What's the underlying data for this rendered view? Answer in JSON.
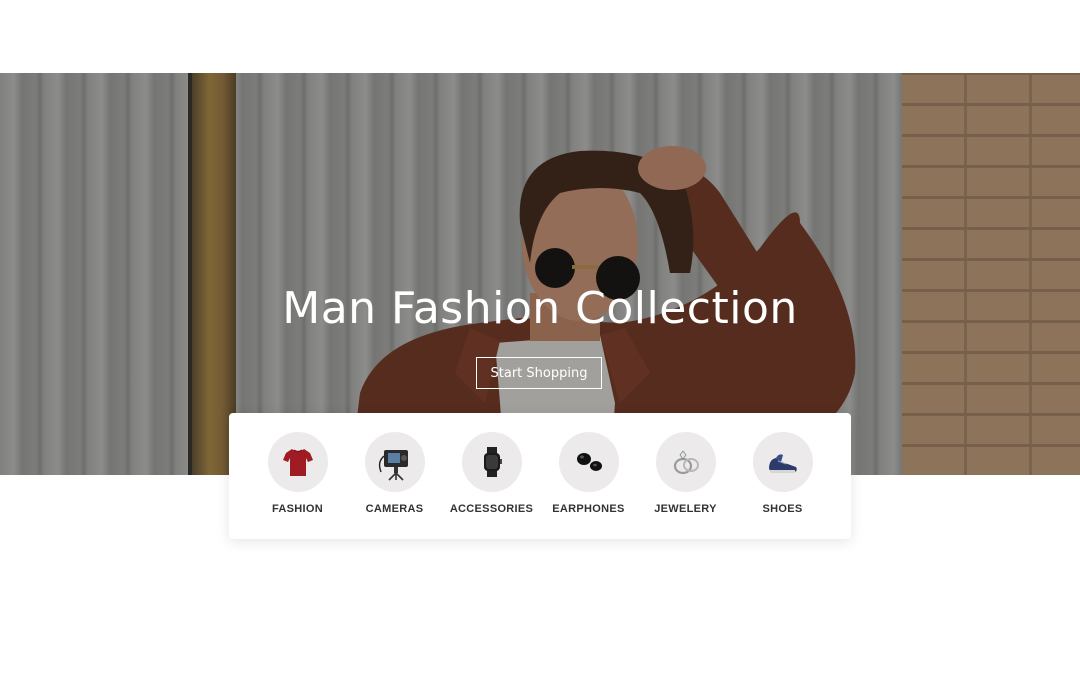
{
  "hero": {
    "title": "Man Fashion Collection",
    "cta_label": "Start Shopping"
  },
  "categories": [
    {
      "label": "FASHION",
      "icon": "tshirt-icon"
    },
    {
      "label": "CAMERAS",
      "icon": "camera-icon"
    },
    {
      "label": "ACCESSORIES",
      "icon": "smartwatch-icon"
    },
    {
      "label": "EARPHONES",
      "icon": "earbuds-icon"
    },
    {
      "label": "JEWELERY",
      "icon": "ring-icon"
    },
    {
      "label": "SHOES",
      "icon": "shoe-icon"
    }
  ],
  "colors": {
    "overlay": "#000000",
    "icon_bg": "#eceaea",
    "shirt": "#a01c24"
  }
}
